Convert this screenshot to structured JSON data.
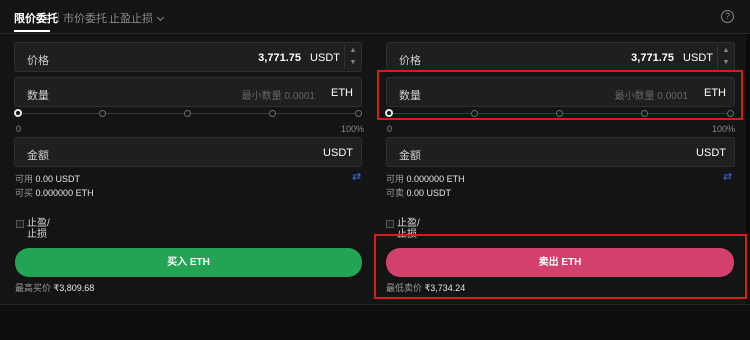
{
  "tabs": [
    {
      "label": "限价委托",
      "active": true
    },
    {
      "label": "市价委托",
      "active": false
    },
    {
      "label": "止盈止损",
      "active": false
    }
  ],
  "help_icon": "question-circle-icon",
  "help_glyph": "?",
  "buy": {
    "price": {
      "label": "价格",
      "value": "3,771.75",
      "unit": "USDT"
    },
    "qty": {
      "label": "数量",
      "placeholder": "最小数量 0.0001",
      "unit": "ETH"
    },
    "slider": {
      "min": "0",
      "max": "100%",
      "level": 0
    },
    "amount": {
      "label": "金额",
      "unit": "USDT"
    },
    "available": {
      "label": "可用",
      "value": "0.00 USDT"
    },
    "can_trade": {
      "label": "可买",
      "value": "0.000000 ETH"
    },
    "tpsl_label": "止盈/止损",
    "button": "买入 ETH",
    "price_note": {
      "label": "最高买价",
      "value": "₹3,809.68"
    }
  },
  "sell": {
    "price": {
      "label": "价格",
      "value": "3,771.75",
      "unit": "USDT"
    },
    "qty": {
      "label": "数量",
      "placeholder": "最小数量 0.0001",
      "unit": "ETH"
    },
    "slider": {
      "min": "0",
      "max": "100%",
      "level": 0
    },
    "amount": {
      "label": "金额",
      "unit": "USDT"
    },
    "available": {
      "label": "可用",
      "value": "0.000000 ETH"
    },
    "can_trade": {
      "label": "可卖",
      "value": "0.00 USDT"
    },
    "tpsl_label": "止盈/止损",
    "button": "卖出 ETH",
    "price_note": {
      "label": "最低卖价",
      "value": "₹3,734.24"
    }
  },
  "colors": {
    "buy": "#23a455",
    "sell": "#d2416b",
    "highlight": "#d71c1c",
    "swap": "#3a6df0"
  },
  "icons": {
    "step_up": "▲",
    "step_down": "▼",
    "swap": "⇄",
    "swap_name": "swap-arrows-icon"
  }
}
